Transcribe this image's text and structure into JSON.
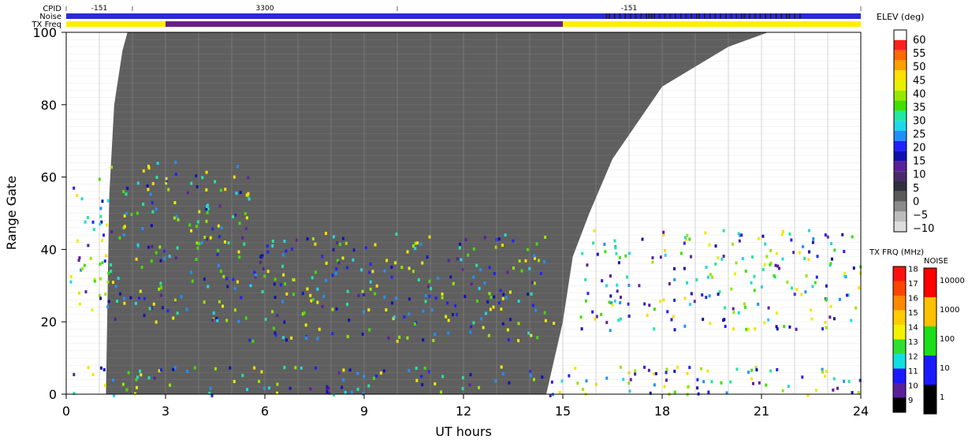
{
  "header": {
    "cpid_label": "CPID",
    "noise_label": "Noise",
    "txfreq_label": "TX Freq",
    "cpid_segments": [
      {
        "start": 0,
        "end": 2.0,
        "label": "-151"
      },
      {
        "start": 2.0,
        "end": 10.0,
        "label": "3300"
      },
      {
        "start": 10.0,
        "end": 24.0,
        "label": "-151"
      }
    ],
    "txfreq_segments": [
      {
        "start": 0,
        "end": 3.0,
        "color": "#ffee00"
      },
      {
        "start": 3.0,
        "end": 15.0,
        "color": "#6a1d8c"
      },
      {
        "start": 15.0,
        "end": 24.0,
        "color": "#ffee00"
      }
    ],
    "noise_color": "#2a2ad8",
    "noise_dark_span": {
      "start": 16.3,
      "end": 22.2,
      "color": "#222222"
    }
  },
  "colors": {
    "groundscatter": "#5f5f5f",
    "tx_freq_band": "#ffee00",
    "tx_freq_alt": "#6a1d8c",
    "noise_band": "#2a2ad8"
  },
  "elev_scale": {
    "title": "ELEV (deg)",
    "labels": [
      "60",
      "55",
      "50",
      "45",
      "40",
      "35",
      "30",
      "25",
      "20",
      "15",
      "10",
      "5",
      "0",
      "−5",
      "−10"
    ],
    "colors": [
      "#ffffff",
      "#ff2020",
      "#ff6a00",
      "#ff9f00",
      "#ffe000",
      "#e8f000",
      "#98e800",
      "#40e000",
      "#20e8a0",
      "#20d8e8",
      "#2090ff",
      "#2020ff",
      "#1010b0",
      "#5a1f9a",
      "#4a2a6a",
      "#303040",
      "#5a5a5a",
      "#8a8a8a",
      "#bcbcbc",
      "#dddddd"
    ]
  },
  "txfrq_scale": {
    "title": "TX FRQ (MHz)",
    "labels": [
      "18",
      "17",
      "16",
      "15",
      "14",
      "13",
      "12",
      "11",
      "10",
      "9"
    ],
    "colors": [
      "#ff1010",
      "#ff4400",
      "#ff8800",
      "#ffcc00",
      "#f2f200",
      "#30e030",
      "#10e0e0",
      "#1a1aff",
      "#5a1f9a",
      "#000000"
    ]
  },
  "noise_scale": {
    "title": "NOISE",
    "labels": [
      "10000",
      "1000",
      "100",
      "10",
      "1"
    ],
    "colors": [
      "#ff0000",
      "#ffc000",
      "#1adf1a",
      "#1a1aff",
      "#000000"
    ]
  },
  "chart_data": {
    "type": "heatmap",
    "title": "",
    "xlabel": "UT hours",
    "ylabel": "Range Gate",
    "xlim": [
      0,
      24
    ],
    "ylim": [
      0,
      100
    ],
    "x_ticks": [
      "0",
      "3",
      "6",
      "9",
      "12",
      "15",
      "18",
      "21",
      "24"
    ],
    "y_ticks": [
      "0",
      "20",
      "40",
      "60",
      "80",
      "100"
    ],
    "groundscatter_region": {
      "description_color": "grey",
      "boundary": [
        {
          "x": 1.2,
          "y": 0
        },
        {
          "x": 1.3,
          "y": 55
        },
        {
          "x": 1.45,
          "y": 80
        },
        {
          "x": 1.7,
          "y": 95
        },
        {
          "x": 1.85,
          "y": 100
        }
      ],
      "upper_edge": [
        {
          "x": 1.85,
          "y": 100
        },
        {
          "x": 21.2,
          "y": 100
        }
      ],
      "right_boundary": [
        {
          "x": 21.2,
          "y": 100
        },
        {
          "x": 20.0,
          "y": 96
        },
        {
          "x": 18.0,
          "y": 85
        },
        {
          "x": 16.5,
          "y": 65
        },
        {
          "x": 15.8,
          "y": 50
        },
        {
          "x": 15.3,
          "y": 38
        },
        {
          "x": 15.0,
          "y": 20
        },
        {
          "x": 14.6,
          "y": 4
        },
        {
          "x": 14.5,
          "y": 0
        }
      ]
    },
    "scatter_regions": [
      {
        "x": [
          0.1,
          1.2
        ],
        "y": [
          20,
          60
        ],
        "elev_range": [
          20,
          40
        ]
      },
      {
        "x": [
          1.2,
          5.5
        ],
        "y": [
          20,
          65
        ],
        "elev_range": [
          10,
          45
        ]
      },
      {
        "x": [
          5.5,
          14.7
        ],
        "y": [
          15,
          45
        ],
        "elev_range": [
          10,
          50
        ]
      },
      {
        "x": [
          15.5,
          24
        ],
        "y": [
          18,
          46
        ],
        "elev_range": [
          15,
          40
        ]
      },
      {
        "x": [
          0,
          24
        ],
        "y": [
          0,
          8
        ],
        "elev_range": [
          10,
          40
        ]
      }
    ]
  }
}
